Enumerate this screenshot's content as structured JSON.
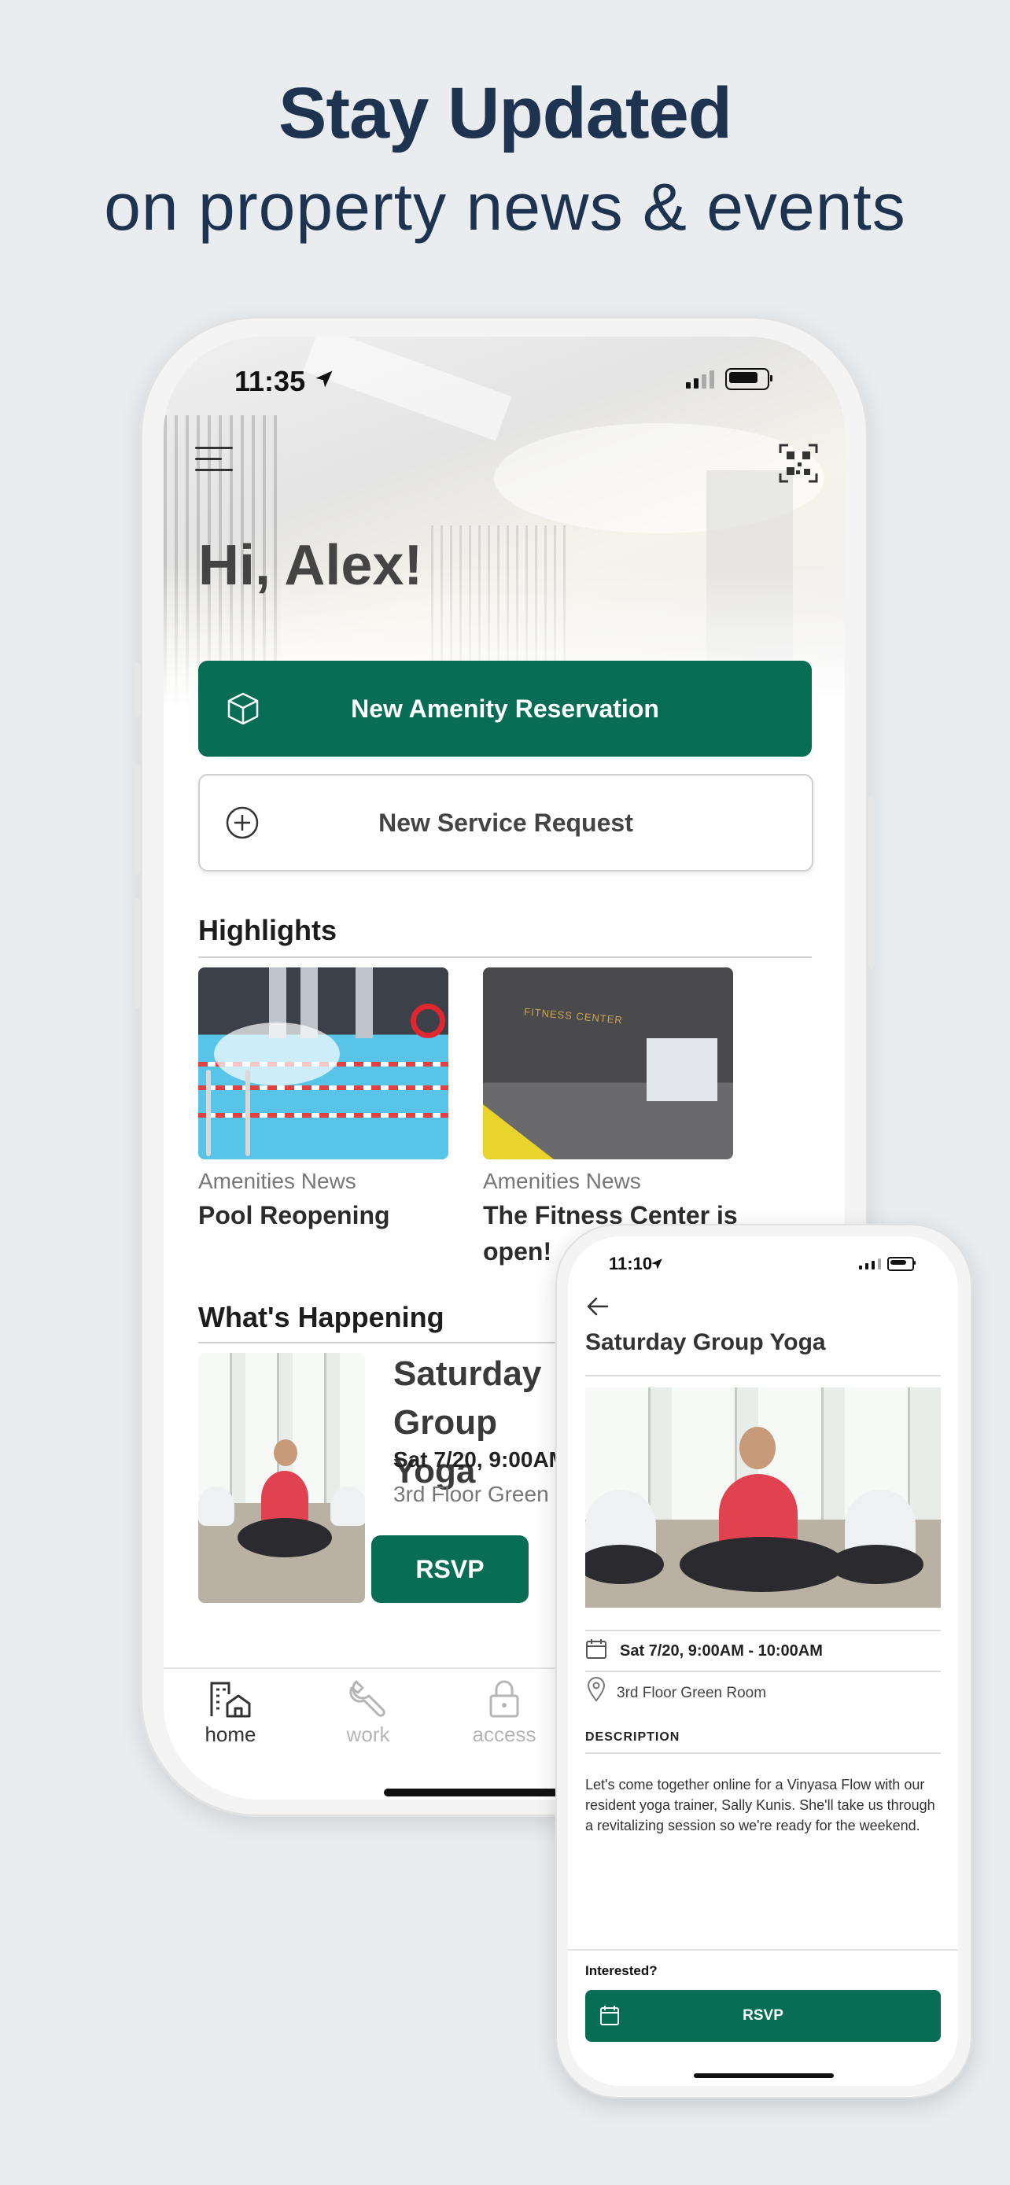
{
  "headline": {
    "title": "Stay Updated",
    "subtitle": "on property news & events"
  },
  "main_phone": {
    "status": {
      "time": "11:35"
    },
    "greeting": "Hi, Alex!",
    "primary_action": {
      "label": "New Amenity Reservation",
      "icon": "cube-icon"
    },
    "secondary_action": {
      "label": "New Service Request",
      "icon": "plus-circle-icon"
    },
    "highlights": {
      "title": "Highlights",
      "items": [
        {
          "category": "Amenities News",
          "title": "Pool Reopening",
          "image": "pool-image"
        },
        {
          "category": "Amenities News",
          "title": "The Fitness Center is open!",
          "image": "fitness-center-image"
        }
      ]
    },
    "whats_happening": {
      "title": "What's Happening",
      "event": {
        "title": "Saturday Group Yoga",
        "date": "Sat 7/20, 9:00AM - 10:00AM",
        "location": "3rd Floor Green Room",
        "rsvp_label": "RSVP"
      }
    },
    "tabs": [
      {
        "label": "home",
        "icon": "building-home-icon",
        "active": true
      },
      {
        "label": "work",
        "icon": "wrench-icon",
        "active": false
      },
      {
        "label": "access",
        "icon": "lock-icon",
        "active": false
      }
    ]
  },
  "detail_phone": {
    "status": {
      "time": "11:10"
    },
    "title": "Saturday Group Yoga",
    "date": "Sat 7/20, 9:00AM - 10:00AM",
    "location": "3rd Floor Green Room",
    "description_label": "DESCRIPTION",
    "description": "Let's come together online for a Vinyasa Flow with our resident yoga trainer, Sally Kunis. She'll take us through a revitalizing session so we're ready for the weekend.",
    "interested_label": "Interested?",
    "rsvp_label": "RSVP"
  },
  "colors": {
    "brand_green": "#076d54",
    "headline_navy": "#1e3350",
    "background": "#eaedf0"
  }
}
